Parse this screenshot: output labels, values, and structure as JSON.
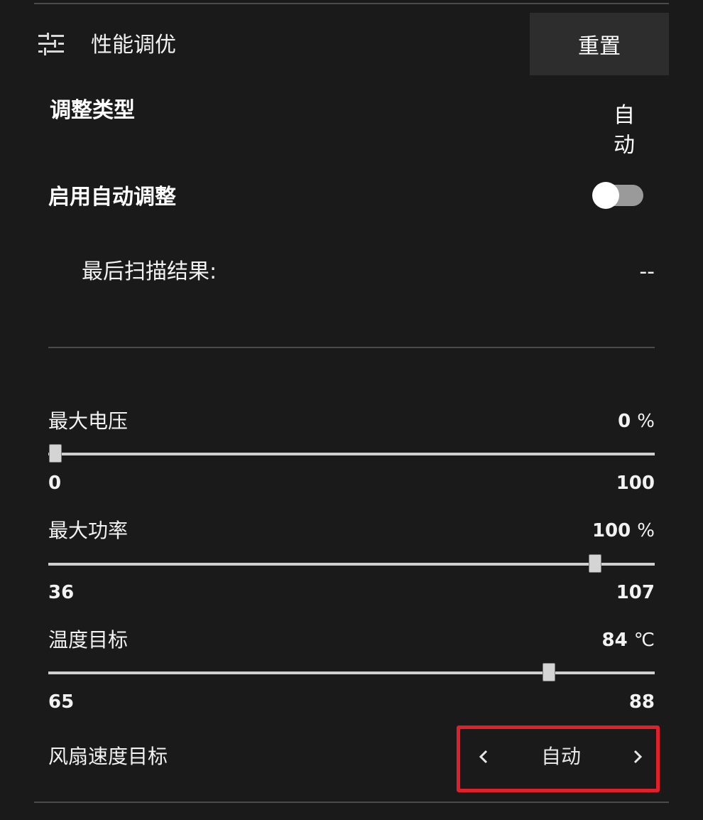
{
  "header": {
    "title": "性能调优",
    "reset_label": "重置"
  },
  "tuning": {
    "type_label": "调整类型",
    "type_value_line1": "自",
    "type_value_line2": "动",
    "auto_label": "启用自动调整",
    "auto_enabled": false,
    "scan_label": "最后扫描结果:",
    "scan_value": "--"
  },
  "sliders": {
    "voltage": {
      "label": "最大电压",
      "value": "0",
      "unit": "%",
      "min": "0",
      "max": "100",
      "level": 0
    },
    "power": {
      "label": "最大功率",
      "value": "100",
      "unit": "%",
      "min": "36",
      "max": "107",
      "level": 100
    },
    "temp": {
      "label": "温度目标",
      "value": "84",
      "unit": "℃",
      "min": "65",
      "max": "88",
      "level": 84
    }
  },
  "fan": {
    "label": "风扇速度目标",
    "value": "自动"
  },
  "colors": {
    "background": "#1a1a1a",
    "reset_button": "#2d2d2d",
    "highlight_border": "#e0202a"
  }
}
